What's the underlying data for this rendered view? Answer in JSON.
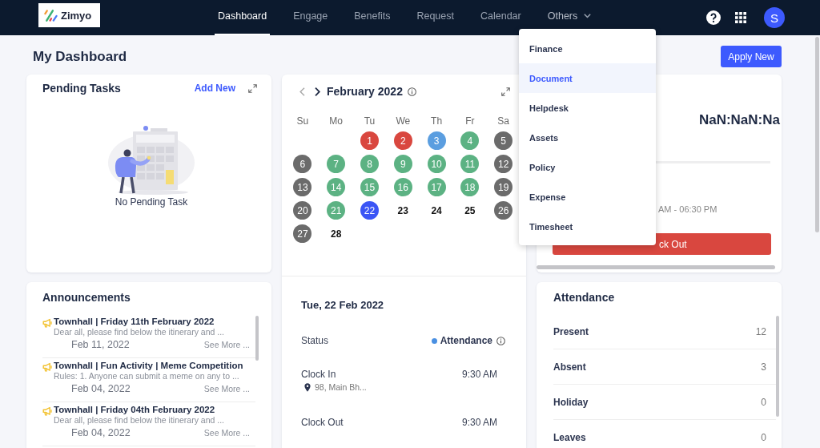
{
  "nav": {
    "logo": "Zimyo",
    "tabs": [
      {
        "label": "Dashboard",
        "selected": true
      },
      {
        "label": "Engage",
        "selected": false
      },
      {
        "label": "Benefits",
        "selected": false
      },
      {
        "label": "Request",
        "selected": false
      },
      {
        "label": "Calendar",
        "selected": false
      }
    ],
    "others": {
      "label": "Others",
      "expanded": true,
      "items": [
        {
          "label": "Finance",
          "selected": false
        },
        {
          "label": "Document",
          "selected": true
        },
        {
          "label": "Helpdesk",
          "selected": false
        },
        {
          "label": "Assets",
          "selected": false
        },
        {
          "label": "Policy",
          "selected": false
        },
        {
          "label": "Expense",
          "selected": false
        },
        {
          "label": "Timesheet",
          "selected": false
        }
      ]
    },
    "avatar": "S"
  },
  "page": {
    "title": "My Dashboard",
    "action": "Apply New"
  },
  "pending_tasks": {
    "title": "Pending Tasks",
    "action": "Add New",
    "empty_text": "No Pending Task"
  },
  "announcements": {
    "title": "Announcements",
    "items": [
      {
        "title": "Townhall | Friday 11th February 2022",
        "summary": "Dear all, please find below the itinerary and ...",
        "date": "Feb 11, 2022",
        "link": "See More ..."
      },
      {
        "title": "Townhall | Fun Activity | Meme Competition",
        "summary": "Rules: 1. Anyone can submit a meme on any to ...",
        "date": "Feb 04, 2022",
        "link": "See More ..."
      },
      {
        "title": "Townhall | Friday 04th February 2022",
        "summary": "Dear all, please find below the itinerary and ...",
        "date": "Feb 04, 2022",
        "link": "See More ..."
      }
    ]
  },
  "calendar": {
    "month": "February 2022",
    "weekdays": [
      "Su",
      "Mo",
      "Tu",
      "We",
      "Th",
      "Fr",
      "Sa"
    ],
    "weeks": [
      [
        {
          "day": "1",
          "color": "#d9473f"
        },
        {
          "day": "2",
          "color": "#d9473f"
        },
        {
          "day": "3",
          "color": "#5b9ee0"
        },
        {
          "day": "4",
          "color": "#5cb283"
        },
        {
          "day": "5",
          "color": "#6b6b6b"
        }
      ],
      [
        {
          "day": "6",
          "color": "#6b6b6b"
        },
        {
          "day": "7",
          "color": "#5cb283"
        },
        {
          "day": "8",
          "color": "#5cb283"
        },
        {
          "day": "9",
          "color": "#5cb283"
        },
        {
          "day": "10",
          "color": "#5cb283"
        },
        {
          "day": "11",
          "color": "#5cb283"
        },
        {
          "day": "12",
          "color": "#6b6b6b"
        }
      ],
      [
        {
          "day": "13",
          "color": "#6b6b6b"
        },
        {
          "day": "14",
          "color": "#5cb283"
        },
        {
          "day": "15",
          "color": "#5cb283"
        },
        {
          "day": "16",
          "color": "#5cb283"
        },
        {
          "day": "17",
          "color": "#5cb283"
        },
        {
          "day": "18",
          "color": "#5cb283"
        },
        {
          "day": "19",
          "color": "#6b6b6b"
        }
      ],
      [
        {
          "day": "20",
          "color": "#6b6b6b"
        },
        {
          "day": "21",
          "color": "#5cb283"
        },
        {
          "day": "22",
          "color": "#3b55f5"
        },
        {
          "day": "23"
        },
        {
          "day": "24"
        },
        {
          "day": "25"
        },
        {
          "day": "26",
          "color": "#6b6b6b"
        }
      ],
      [
        {
          "day": "27",
          "color": "#6b6b6b"
        },
        {
          "day": "28"
        }
      ]
    ]
  },
  "day_detail": {
    "date": "Tue, 22 Feb 2022",
    "rows": [
      {
        "kind": "status",
        "label": "Status",
        "value": "Attendance"
      },
      {
        "kind": "time",
        "label": "Clock In",
        "value": "9:30 AM",
        "location": "98, Main Bh..."
      },
      {
        "kind": "time",
        "label": "Clock Out",
        "value": "9:30 AM"
      }
    ]
  },
  "clock": {
    "timer": "NaN:NaN:Na",
    "shift": "AM - 06:30 PM",
    "button": "ck Out"
  },
  "attendance": {
    "title": "Attendance",
    "rows": [
      {
        "label": "Present",
        "count": "12"
      },
      {
        "label": "Absent",
        "count": "3"
      },
      {
        "label": "Holiday",
        "count": "0"
      },
      {
        "label": "Leaves",
        "count": "0"
      }
    ]
  }
}
